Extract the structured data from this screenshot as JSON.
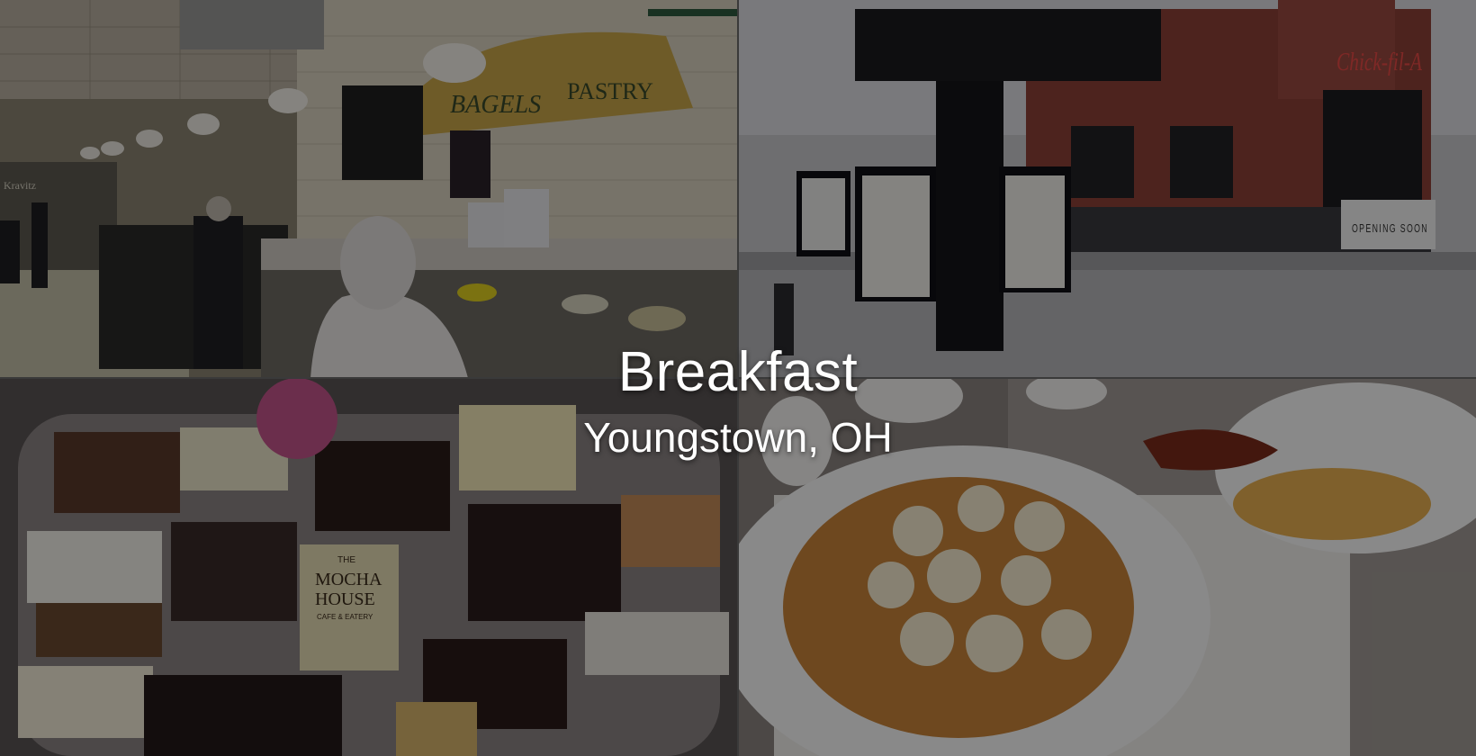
{
  "overlay": {
    "title": "Breakfast",
    "subtitle": "Youngstown, OH"
  },
  "photos": {
    "top_left": {
      "signs": {
        "bagels": "BAGELS",
        "pastry": "PASTRY",
        "krav": "Kravitz"
      }
    },
    "top_right": {
      "signs": {
        "brand": "Chick-fil-A",
        "banner": "OPENING SOON"
      }
    },
    "bottom_left": {
      "card": {
        "the": "THE",
        "name1": "MOCHA",
        "name2": "HOUSE",
        "tag": "CAFE & EATERY"
      }
    },
    "bottom_right": {}
  },
  "colors": {
    "overlay_text": "#ffffff",
    "awning": "#c9a64a",
    "brand_red": "#b8322f"
  }
}
